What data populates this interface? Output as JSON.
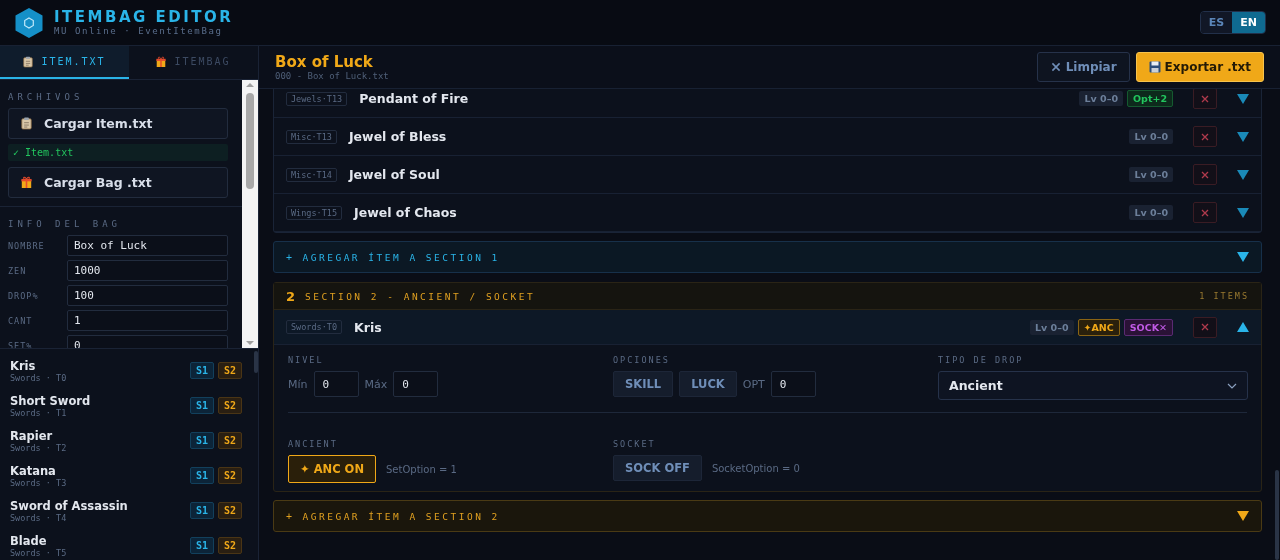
{
  "app": {
    "title": "ITEMBAG EDITOR",
    "subtitle": "MU Online · EventItemBag"
  },
  "languages": [
    {
      "label": "ES",
      "selected": false
    },
    {
      "label": "EN",
      "selected": true
    }
  ],
  "sidebar": {
    "tabs": [
      {
        "label": "ITEM.TXT",
        "selected": true
      },
      {
        "label": "ITEMBAG",
        "selected": false
      }
    ],
    "files_heading": "ARCHIVOS",
    "files": [
      {
        "kind": "button",
        "label": "Cargar Item.txt"
      },
      {
        "kind": "status",
        "label": "✓ Item.txt"
      },
      {
        "kind": "button",
        "label": "Cargar Bag .txt"
      }
    ],
    "info_heading": "INFO DEL BAG",
    "fields": [
      {
        "label": "NOMBRE",
        "value": "Box of Luck"
      },
      {
        "label": "ZEN",
        "value": "1000"
      },
      {
        "label": "DROP%",
        "value": "100"
      },
      {
        "label": "CANT",
        "value": "1"
      },
      {
        "label": "SET%",
        "value": "0"
      }
    ],
    "items": [
      {
        "name": "Kris",
        "meta": "Swords · T0",
        "sections": [
          "S1",
          "S2"
        ]
      },
      {
        "name": "Short Sword",
        "meta": "Swords · T1",
        "sections": [
          "S1",
          "S2"
        ]
      },
      {
        "name": "Rapier",
        "meta": "Swords · T2",
        "sections": [
          "S1",
          "S2"
        ]
      },
      {
        "name": "Katana",
        "meta": "Swords · T3",
        "sections": [
          "S1",
          "S2"
        ]
      },
      {
        "name": "Sword of Assassin",
        "meta": "Swords · T4",
        "sections": [
          "S1",
          "S2"
        ]
      },
      {
        "name": "Blade",
        "meta": "Swords · T5",
        "sections": [
          "S1",
          "S2"
        ]
      }
    ]
  },
  "main": {
    "title": "Box of Luck",
    "subtitle": "000 - Box of Luck.txt",
    "actions": [
      {
        "kind": "secondary",
        "label": "Limpiar"
      },
      {
        "kind": "primary",
        "label": "Exportar .txt"
      }
    ],
    "sections": [
      {
        "kind": "normal",
        "add_icon": "+",
        "add_label": "AGREGAR ÍTEM A SECTION 1",
        "items": [
          {
            "tag": "Jewels·T13",
            "name": "Pendant of Fire",
            "expanded": false,
            "badges": [
              {
                "kind": "level",
                "text": "Lv 0–0"
              },
              {
                "kind": "opt",
                "text": "Opt+2"
              }
            ]
          },
          {
            "tag": "Misc·T13",
            "name": "Jewel of Bless",
            "expanded": false,
            "badges": [
              {
                "kind": "level",
                "text": "Lv 0–0"
              }
            ]
          },
          {
            "tag": "Misc·T14",
            "name": "Jewel of Soul",
            "expanded": false,
            "badges": [
              {
                "kind": "level",
                "text": "Lv 0–0"
              }
            ]
          },
          {
            "tag": "Wings·T15",
            "name": "Jewel of Chaos",
            "expanded": false,
            "badges": [
              {
                "kind": "level",
                "text": "Lv 0–0"
              }
            ]
          }
        ]
      },
      {
        "kind": "ancient",
        "number": "2",
        "title": "SECTION 2 - ANCIENT / SOCKET",
        "count": "1 ITEMS",
        "add_icon": "+",
        "add_label": "AGREGAR ÍTEM A SECTION 2",
        "items": [
          {
            "tag": "Swords·T0",
            "name": "Kris",
            "expanded": true,
            "badges": [
              {
                "kind": "level",
                "text": "Lv 0–0"
              },
              {
                "kind": "anc",
                "text": "✦ANC"
              },
              {
                "kind": "sock",
                "text": "SOCK✕"
              }
            ],
            "details": {
              "level": {
                "heading": "NIVEL",
                "min_label": "Mín",
                "min": "0",
                "max_label": "Máx",
                "max": "0"
              },
              "options": {
                "heading": "OPCIONES",
                "skill": {
                  "label": "SKILL",
                  "on": false
                },
                "luck": {
                  "label": "LUCK",
                  "on": false
                },
                "opt_label": "OPT",
                "opt": "0"
              },
              "drop": {
                "heading": "TIPO DE DROP",
                "value": "Ancient"
              },
              "ancient": {
                "heading": "ANCIENT",
                "label": "✦ ANC ON",
                "on": true,
                "note": "SetOption = 1"
              },
              "socket": {
                "heading": "SOCKET",
                "label": "SOCK OFF",
                "on": false,
                "note": "SocketOption = 0"
              }
            }
          }
        ]
      }
    ]
  }
}
